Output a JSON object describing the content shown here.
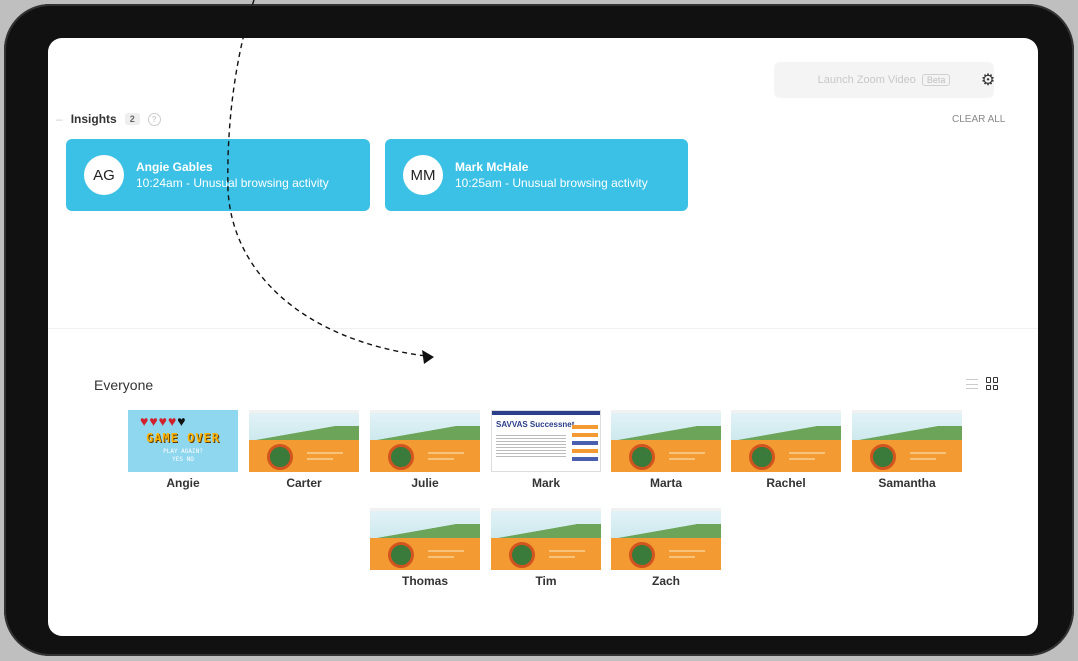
{
  "header": {
    "zoom_button_label": "Launch Zoom Video",
    "beta_badge": "Beta",
    "settings_icon": "gear-icon"
  },
  "insights": {
    "title": "Insights",
    "count": "2",
    "help_icon": "question-icon",
    "clear_all": "CLEAR ALL",
    "accent_color": "#3cc1e6",
    "cards": [
      {
        "initials": "AG",
        "name": "Angie Gables",
        "detail": "10:24am - Unusual browsing activity"
      },
      {
        "initials": "MM",
        "name": "Mark McHale",
        "detail": "10:25am - Unusual browsing activity"
      }
    ]
  },
  "everyone": {
    "title": "Everyone",
    "view_icons": [
      "list-view-icon",
      "grid-view-icon"
    ],
    "students": [
      {
        "name": "Angie",
        "screen": "game-over"
      },
      {
        "name": "Carter",
        "screen": "game"
      },
      {
        "name": "Julie",
        "screen": "game"
      },
      {
        "name": "Mark",
        "screen": "document"
      },
      {
        "name": "Marta",
        "screen": "game"
      },
      {
        "name": "Rachel",
        "screen": "game"
      },
      {
        "name": "Samantha",
        "screen": "game"
      },
      {
        "name": "Thomas",
        "screen": "game"
      },
      {
        "name": "Tim",
        "screen": "game"
      },
      {
        "name": "Zach",
        "screen": "game"
      }
    ],
    "game_over_thumb": {
      "title": "GAME OVER",
      "line1": "PLAY AGAIN?",
      "line2": "YES  NO"
    },
    "document_thumb": {
      "title": "SAVVAS Successnet"
    }
  }
}
